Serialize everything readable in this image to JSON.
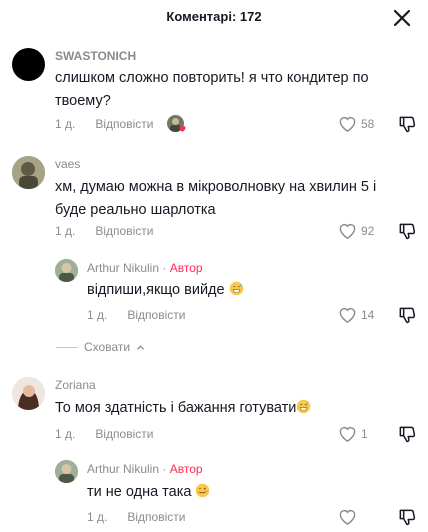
{
  "header": {
    "title": "Коментарі: 172"
  },
  "comments": [
    {
      "author": "SWASTONICH",
      "text": "слишком сложно повторить! я что кондитер по твоему?",
      "time": "1 д.",
      "reply_label": "Відповісти",
      "likes": "58"
    },
    {
      "author": "vaes",
      "text": "хм, думаю можна в мікроволновку на хвилин 5 і буде реально шарлотка",
      "time": "1 д.",
      "reply_label": "Відповісти",
      "likes": "92"
    },
    {
      "author": "Arthur Nikulin",
      "badge_sep": "·",
      "badge": "Автор",
      "text": "відпиши,якщо вийде",
      "time": "1 д.",
      "reply_label": "Відповісти",
      "likes": "14"
    },
    {
      "author": "Zoriana",
      "text": "То моя здатність і бажання готувати",
      "time": "1 д.",
      "reply_label": "Відповісти",
      "likes": "1"
    },
    {
      "author": "Arthur Nikulin",
      "badge_sep": "·",
      "badge": "Автор",
      "text": "ти не одна така",
      "time": "1 д.",
      "reply_label": "Відповісти"
    }
  ],
  "hide_replies": {
    "label": "Сховати"
  },
  "colors": {
    "author_badge": "#fe2c55",
    "muted": "#8a8b91",
    "text": "#161823"
  },
  "icons": [
    "close-icon",
    "heart-icon",
    "dislike-icon",
    "chevron-up-icon",
    "emoji-icon"
  ]
}
